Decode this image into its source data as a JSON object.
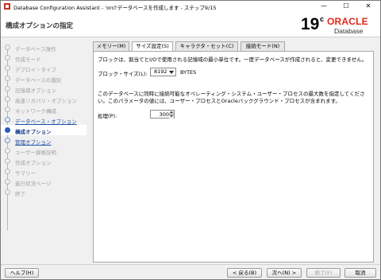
{
  "window": {
    "title": "Database Configuration Assistant - 'orcl'データベースを作成します - ステップ9/15",
    "minimize": "—",
    "maximize": "☐",
    "close": "✕"
  },
  "header": {
    "page_title": "構成オプションの指定",
    "logo": {
      "version": "19",
      "suffix": "c",
      "brand": "ORACLE",
      "product": "Database"
    }
  },
  "sidebar": {
    "steps": [
      {
        "label": "データベース操作",
        "state": "disabled"
      },
      {
        "label": "作成モード",
        "state": "disabled"
      },
      {
        "label": "デプロイ・タイプ",
        "state": "disabled"
      },
      {
        "label": "データベースの識別",
        "state": "disabled"
      },
      {
        "label": "記憶域オプション",
        "state": "disabled"
      },
      {
        "label": "高速リカバリ・オプション",
        "state": "disabled"
      },
      {
        "label": "ネットワーク構成",
        "state": "disabled"
      },
      {
        "label": "データベース・オプション",
        "state": "link"
      },
      {
        "label": "構成オプション",
        "state": "current"
      },
      {
        "label": "管理オプション",
        "state": "link"
      },
      {
        "label": "ユーザー資格証明",
        "state": "disabled"
      },
      {
        "label": "作成オプション",
        "state": "disabled"
      },
      {
        "label": "サマリー",
        "state": "disabled"
      },
      {
        "label": "進行状況ページ",
        "state": "disabled"
      },
      {
        "label": "終了",
        "state": "disabled"
      }
    ]
  },
  "tabs": [
    {
      "label": "メモリー(M)"
    },
    {
      "label": "サイズ設定(S)"
    },
    {
      "label": "キャラクタ・セット(C)"
    },
    {
      "label": "接続モード(N)"
    }
  ],
  "active_tab": 1,
  "panel": {
    "block_desc": "ブロックは、割当てとI/Oで使用される記憶域の最小単位です。一度データベースが作成されると、変更できません。",
    "block_label": "ブロック・サイズ(L):",
    "block_value": "8192",
    "block_unit": "BYTES",
    "process_desc_1": "このデータベースに同時に接続可能なオペレーティング・システム・ユーザー・プロセスの最大数を指定してくださ",
    "process_desc_2": "い。このパラメータの値には、ユーザー・プロセスとOracleバックグラウンド・プロセスが含まれます。",
    "process_label": "処理(P):",
    "process_value": "300"
  },
  "footer": {
    "help": "ヘルプ(H)",
    "back": "< 戻る(B)",
    "next": "次へ(N) >",
    "finish": "終了(F)",
    "cancel": "取消"
  },
  "colors": {
    "oracle_red": "#e3261a",
    "link_blue": "#1d4ea6",
    "current_step": "#2a5bb5"
  }
}
